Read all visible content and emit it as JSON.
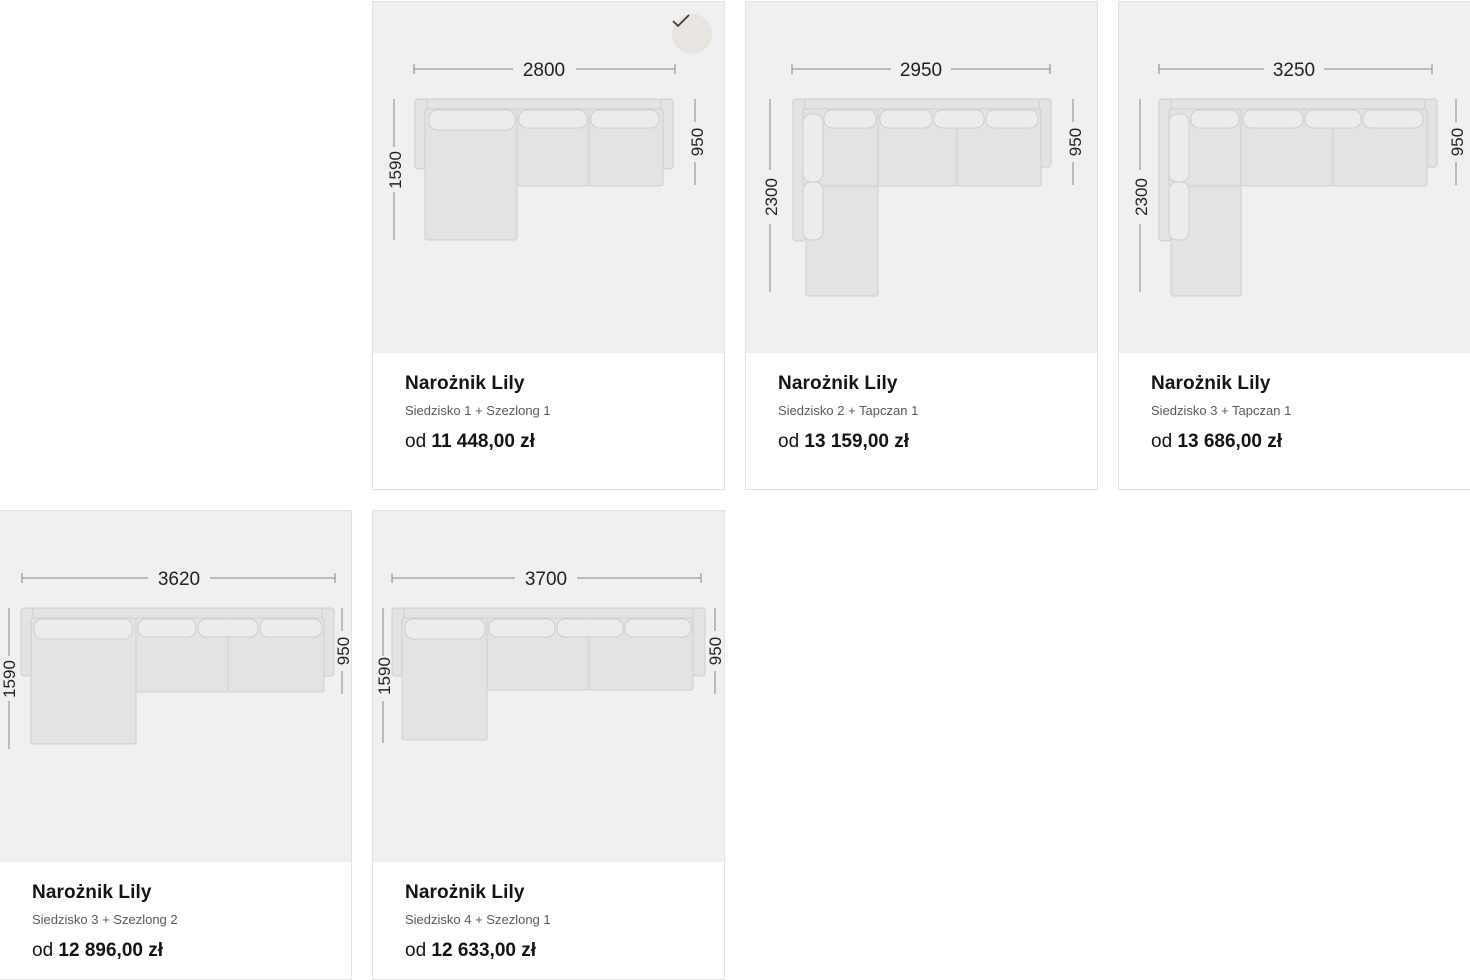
{
  "products": [
    {
      "title": "Narożnik Lily",
      "subtitle": "Siedzisko 1 + Szezlong 1",
      "price_prefix": "od",
      "price": "11 448,00 zł",
      "width_dim": "2800",
      "left_dim": "1590",
      "right_dim": "950",
      "selected": true
    },
    {
      "title": "Narożnik Lily",
      "subtitle": "Siedzisko 2 + Tapczan 1",
      "price_prefix": "od",
      "price": "13 159,00 zł",
      "width_dim": "2950",
      "left_dim": "2300",
      "right_dim": "950",
      "selected": false
    },
    {
      "title": "Narożnik Lily",
      "subtitle": "Siedzisko 3 + Tapczan 1",
      "price_prefix": "od",
      "price": "13 686,00 zł",
      "width_dim": "3250",
      "left_dim": "2300",
      "right_dim": "950",
      "selected": false
    },
    {
      "title": "Narożnik Lily",
      "subtitle": "Siedzisko 3 + Szezlong 2",
      "price_prefix": "od",
      "price": "12 896,00 zł",
      "width_dim": "3620",
      "left_dim": "1590",
      "right_dim": "950",
      "selected": false
    },
    {
      "title": "Narożnik Lily",
      "subtitle": "Siedzisko 4 + Szezlong 1",
      "price_prefix": "od",
      "price": "12 633,00 zł",
      "width_dim": "3700",
      "left_dim": "1590",
      "right_dim": "950",
      "selected": false
    }
  ],
  "selected_icon": "checkmark-icon",
  "colors": {
    "image_bg": "#f0f0f0",
    "sofa_fill": "#e3e3e3",
    "selected_badge": "#e8e4df"
  }
}
